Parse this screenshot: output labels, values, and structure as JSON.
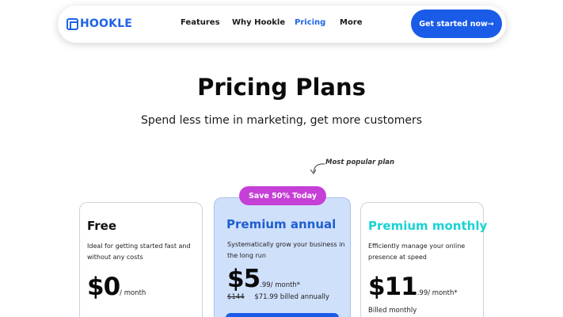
{
  "brand": {
    "name": "HOOKLE",
    "color": "#1f63e6",
    "logo_icon": "hookle-logo-icon"
  },
  "nav": {
    "items": [
      {
        "label": "Features",
        "active": false
      },
      {
        "label": "Why Hookle",
        "active": false
      },
      {
        "label": "Pricing",
        "active": true
      },
      {
        "label": "More",
        "active": false
      }
    ],
    "cta_label": "Get started now→"
  },
  "hero": {
    "title": "Pricing Plans",
    "subtitle": "Spend less time in marketing, get more customers"
  },
  "popular_note": "Most popular plan",
  "badge": {
    "label": "Save 50% Today",
    "color": "#c63fd6"
  },
  "plans": [
    {
      "title": "Free",
      "title_color": "#111111",
      "desc_line1": "Ideal for getting started fast and",
      "desc_line2": "without any costs",
      "price": "$0",
      "price_suffix": "/ month"
    },
    {
      "title": "Premium annual",
      "title_color": "#1f5fcf",
      "desc_line1": "Systematically grow your business in",
      "desc_line2": "the long run",
      "price": "$5",
      "price_suffix": ".99/ month*",
      "old_price": "$144",
      "billed": "$71.99 billed annually"
    },
    {
      "title": "Premium monthly",
      "title_color": "#19d3d3",
      "desc_line1": "Efficiently manage your online",
      "desc_line2": "presence at speed",
      "price": "$11",
      "price_suffix": ".99/ month*",
      "billed": "Billed monthly"
    }
  ]
}
